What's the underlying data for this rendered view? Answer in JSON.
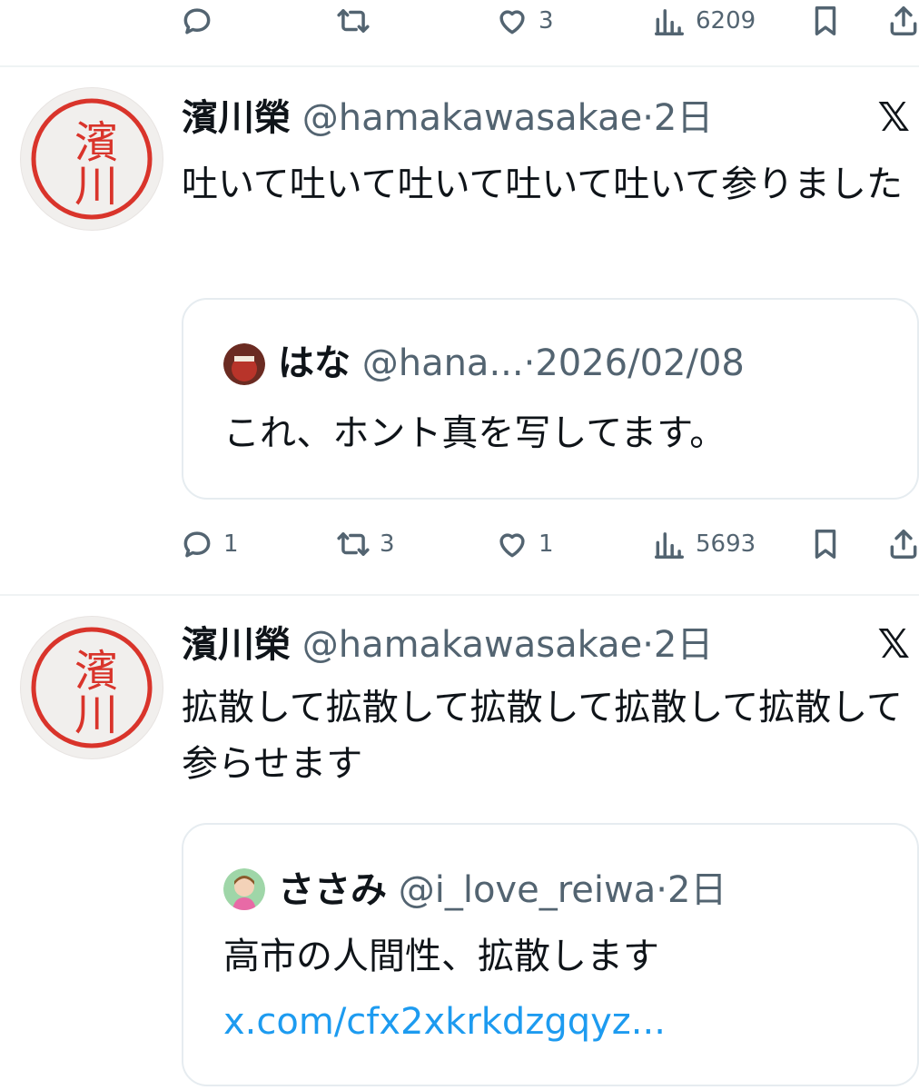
{
  "top_actions": {
    "likes": "3",
    "views": "6209"
  },
  "tweets": [
    {
      "name": "濱川榮",
      "handle": "@hamakawasakae",
      "separator": "·",
      "time": "2日",
      "text": "吐いて吐いて吐いて吐いて吐いて参りました",
      "avatar_text": "濱川",
      "quote": {
        "name": "はな",
        "handle": "@hana...",
        "separator": "·",
        "date": "2026/02/08",
        "text": "これ、ホント真を写してます。"
      },
      "actions": {
        "replies": "1",
        "retweets": "3",
        "likes": "1",
        "views": "5693"
      }
    },
    {
      "name": "濱川榮",
      "handle": "@hamakawasakae",
      "separator": "·",
      "time": "2日",
      "text": "拡散して拡散して拡散して拡散して拡散して参らせます",
      "avatar_text": "濱川",
      "quote": {
        "name": "ささみ",
        "handle": "@i_love_reiwa",
        "separator": "·",
        "date": "2日",
        "text": "高市の人間性、拡散します",
        "link": "x.com/cfx2xkrkdzgqyz..."
      }
    }
  ],
  "icons": {
    "platform": "x-logo-icon",
    "reply": "reply-icon",
    "retweet": "retweet-icon",
    "like": "heart-icon",
    "views": "views-icon",
    "bookmark": "bookmark-icon",
    "share": "share-icon"
  },
  "colors": {
    "text": "#0f1419",
    "secondary": "#536471",
    "link": "#1d9bf0",
    "stamp_red": "#d9342b"
  }
}
